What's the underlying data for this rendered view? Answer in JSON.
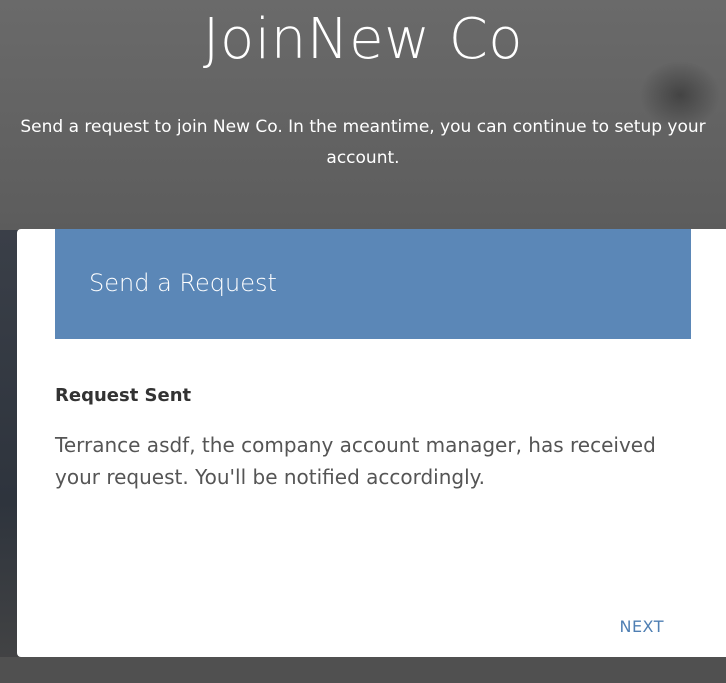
{
  "hero": {
    "title": "JoinNew Co",
    "subtitle": "Send a request to join New Co. In the meantime, you can continue to setup your account."
  },
  "card": {
    "header_title": "Send a Request",
    "status_heading": "Request Sent",
    "status_body": "Terrance asdf, the company account manager, has received your request. You'll be notified accordingly.",
    "next_label": "NEXT"
  },
  "colors": {
    "header_blue": "#5b87b7",
    "link_blue": "#4f7fb3",
    "backdrop": "#5e5e5e"
  }
}
